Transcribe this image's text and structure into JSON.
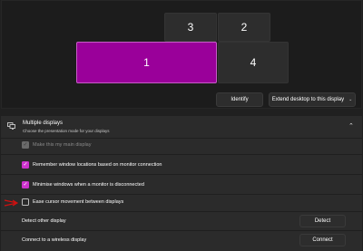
{
  "arrangement": {
    "monitors": [
      {
        "label": "3",
        "selected": false
      },
      {
        "label": "2",
        "selected": false
      },
      {
        "label": "1",
        "selected": true
      },
      {
        "label": "4",
        "selected": false
      }
    ],
    "identify_label": "Identify",
    "mode_dropdown_value": "Extend desktop to this display"
  },
  "multiple_displays": {
    "title": "Multiple displays",
    "subtitle": "Choose the presentation mode for your displays",
    "expanded": true,
    "icon": "displays-icon",
    "options": [
      {
        "label": "Make this my main display",
        "checked": true,
        "enabled": false
      },
      {
        "label": "Remember window locations based on monitor connection",
        "checked": true,
        "enabled": true
      },
      {
        "label": "Minimise windows when a monitor is disconnected",
        "checked": true,
        "enabled": true
      },
      {
        "label": "Ease cursor movement between displays",
        "checked": false,
        "enabled": true
      }
    ],
    "actions": [
      {
        "label": "Detect other display",
        "button": "Detect"
      },
      {
        "label": "Connect to a wireless display",
        "button": "Connect"
      }
    ]
  },
  "colors": {
    "accent": "#cc32cc",
    "selected_monitor": "#9a009a",
    "annotation_arrow": "#d01010"
  }
}
